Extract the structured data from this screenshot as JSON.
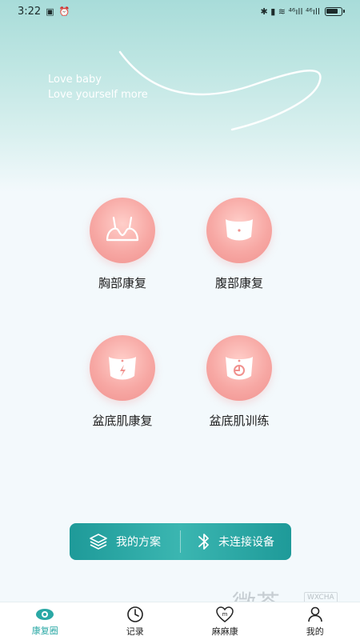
{
  "status_bar": {
    "time": "3:22",
    "right_glyphs": "✱ ▮ ≋ ⁴⁶ıll ⁴⁶ıll"
  },
  "hero": {
    "slogan_line1": "Love baby",
    "slogan_line2": "Love yourself more"
  },
  "modules": [
    {
      "label": "胸部康复",
      "icon": "chest-icon"
    },
    {
      "label": "腹部康复",
      "icon": "abdomen-icon"
    },
    {
      "label": "盆底肌康复",
      "icon": "pelvic-repair-icon"
    },
    {
      "label": "盆底肌训练",
      "icon": "pelvic-training-icon"
    }
  ],
  "actions": {
    "my_plan": "我的方案",
    "device": "未连接设备"
  },
  "tabs": [
    {
      "label": "康复圈",
      "icon": "eye-icon",
      "active": true
    },
    {
      "label": "记录",
      "icon": "clock-icon",
      "active": false
    },
    {
      "label": "麻麻康",
      "icon": "heart-m-icon",
      "active": false
    },
    {
      "label": "我的",
      "icon": "user-icon",
      "active": false
    }
  ],
  "colors": {
    "accent": "#2aa8a5",
    "module_pink": "#f7a8a4",
    "action_bar": "#1e9a99"
  },
  "watermark": {
    "text": "微茶",
    "en": "WXCHA"
  }
}
